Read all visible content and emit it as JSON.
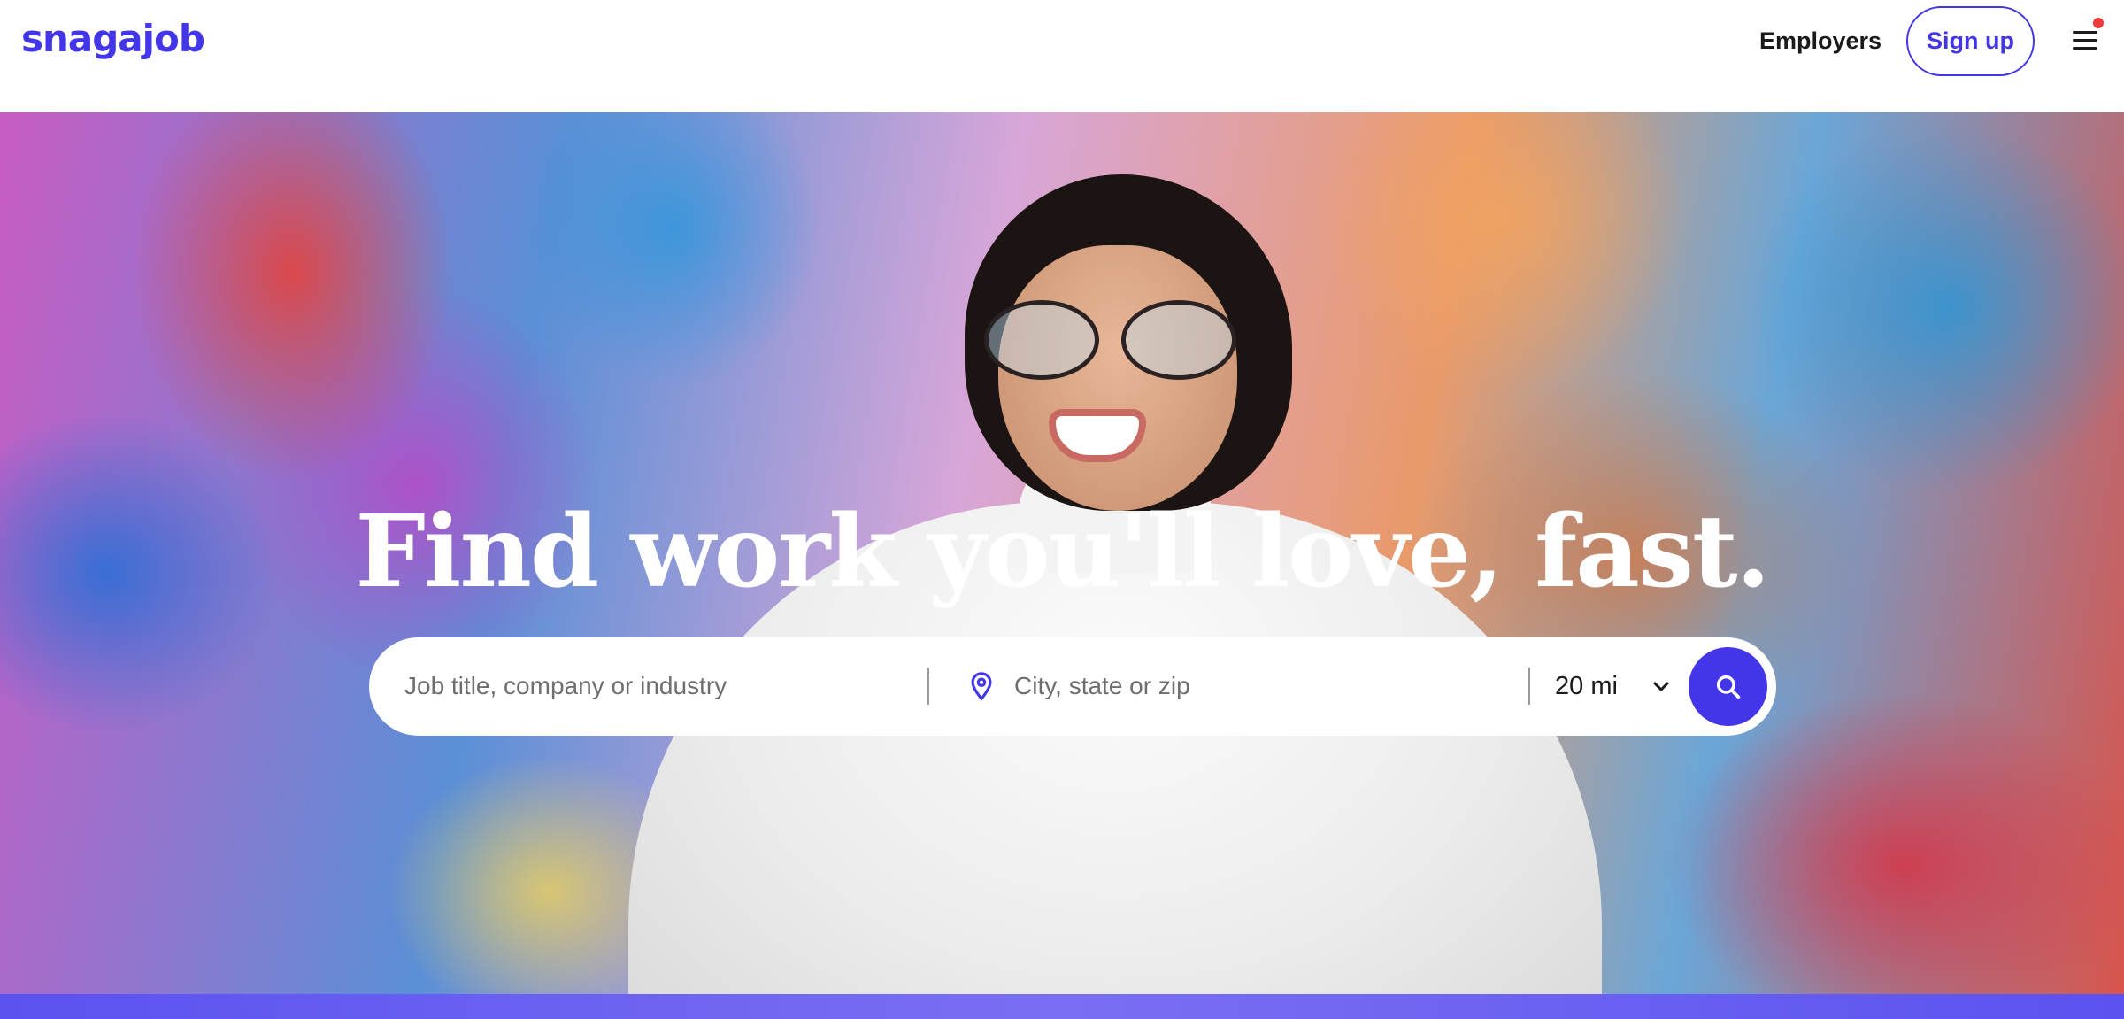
{
  "header": {
    "logo_text": "snagajob",
    "employers_label": "Employers",
    "signup_label": "Sign up",
    "menu_icon": "hamburger-menu-icon",
    "notification_dot_color": "#ec3b3b"
  },
  "hero": {
    "headline": "Find work you'll love, fast."
  },
  "search": {
    "job_placeholder": "Job title, company or industry",
    "location_placeholder": "City, state or zip",
    "location_icon": "location-pin-icon",
    "radius_value": "20 mi",
    "radius_icon": "chevron-down-icon",
    "submit_icon": "search-icon"
  },
  "colors": {
    "brand": "#4236e8",
    "text": "#1a1a1a",
    "placeholder": "#6e6e6e"
  }
}
